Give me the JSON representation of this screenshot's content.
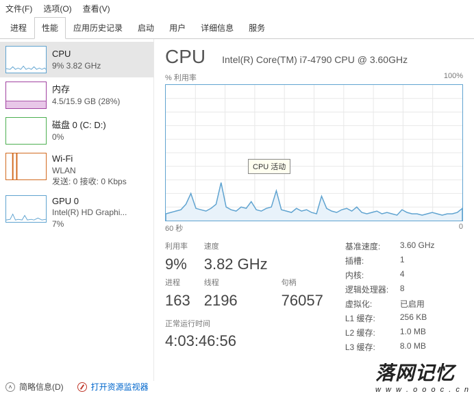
{
  "menu": {
    "file": "文件(F)",
    "options": "选项(O)",
    "view": "查看(V)"
  },
  "tabs": [
    "进程",
    "性能",
    "应用历史记录",
    "启动",
    "用户",
    "详细信息",
    "服务"
  ],
  "active_tab": 1,
  "sidebar": {
    "items": [
      {
        "title": "CPU",
        "line1": "9% 3.82 GHz",
        "line2": ""
      },
      {
        "title": "内存",
        "line1": "4.5/15.9 GB (28%)",
        "line2": ""
      },
      {
        "title": "磁盘 0 (C: D:)",
        "line1": "0%",
        "line2": ""
      },
      {
        "title": "Wi-Fi",
        "line1": "WLAN",
        "line2": "发送: 0 接收: 0 Kbps"
      },
      {
        "title": "GPU 0",
        "line1": "Intel(R) HD Graphi...",
        "line2": "7%"
      }
    ]
  },
  "header": {
    "title": "CPU",
    "model": "Intel(R) Core(TM) i7-4790 CPU @ 3.60GHz"
  },
  "chart_meta": {
    "top_left": "% 利用率",
    "top_right": "100%",
    "bottom_left": "60 秒",
    "bottom_right": "0",
    "tooltip": "CPU 活动"
  },
  "chart_data": {
    "type": "line",
    "xlabel": "seconds",
    "ylabel": "% utilization",
    "ylim": [
      0,
      100
    ],
    "x_range_seconds": [
      60,
      0
    ],
    "values": [
      5,
      6,
      7,
      8,
      12,
      20,
      9,
      8,
      7,
      9,
      12,
      28,
      10,
      8,
      7,
      10,
      9,
      14,
      8,
      7,
      9,
      10,
      22,
      8,
      7,
      6,
      9,
      7,
      8,
      6,
      5,
      18,
      9,
      7,
      6,
      8,
      9,
      7,
      10,
      6,
      5,
      6,
      7,
      5,
      6,
      5,
      4,
      8,
      6,
      5,
      5,
      4,
      5,
      6,
      5,
      4,
      5,
      5,
      6,
      9
    ]
  },
  "stats_left": {
    "util_lbl": "利用率",
    "util_val": "9%",
    "speed_lbl": "速度",
    "speed_val": "3.82 GHz",
    "proc_lbl": "进程",
    "proc_val": "163",
    "threads_lbl": "线程",
    "threads_val": "2196",
    "handles_lbl": "句柄",
    "handles_val": "76057",
    "uptime_lbl": "正常运行时间",
    "uptime_val": "4:03:46:56"
  },
  "stats_right": {
    "base_lbl": "基准速度:",
    "base_val": "3.60 GHz",
    "sockets_lbl": "插槽:",
    "sockets_val": "1",
    "cores_lbl": "内核:",
    "cores_val": "4",
    "lp_lbl": "逻辑处理器:",
    "lp_val": "8",
    "virt_lbl": "虚拟化:",
    "virt_val": "已启用",
    "l1_lbl": "L1 缓存:",
    "l1_val": "256 KB",
    "l2_lbl": "L2 缓存:",
    "l2_val": "1.0 MB",
    "l3_lbl": "L3 缓存:",
    "l3_val": "8.0 MB"
  },
  "footer": {
    "brief": "简略信息(D)",
    "monitor": "打开资源监视器"
  },
  "watermark": {
    "text": "落网记忆",
    "url": "w w w . o o o c . c n"
  }
}
